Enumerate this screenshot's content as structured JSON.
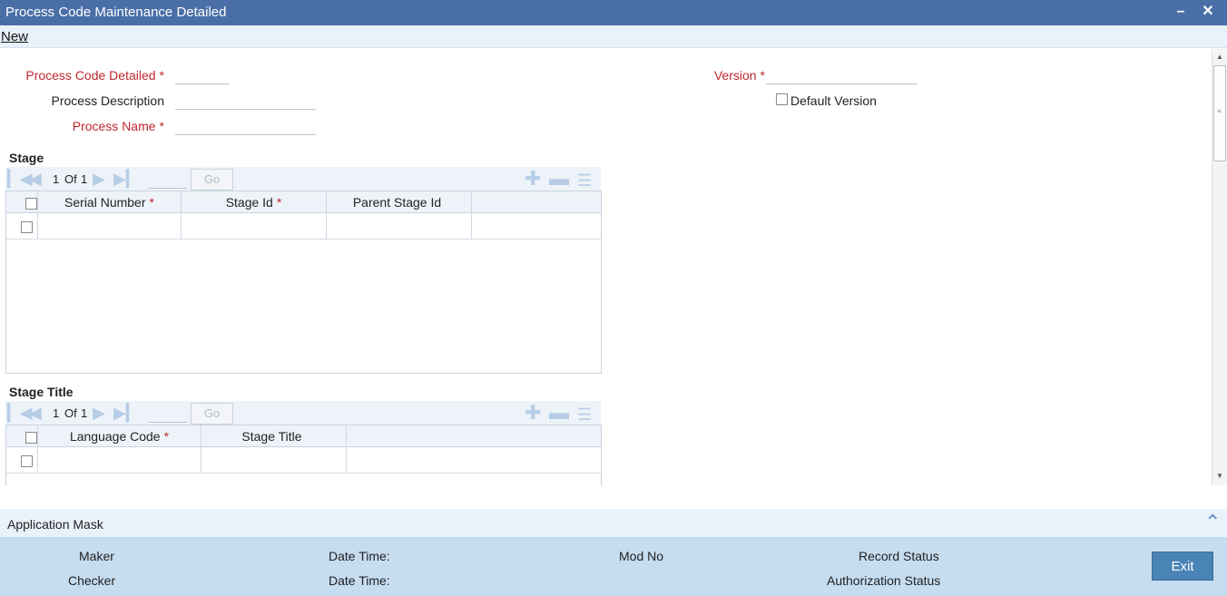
{
  "window": {
    "title": "Process Code Maintenance Detailed"
  },
  "menu": {
    "new_label": "New"
  },
  "form": {
    "process_code_label": "Process Code Detailed",
    "process_description_label": "Process Description",
    "process_name_label": "Process Name",
    "version_label": "Version",
    "default_version_label": "Default Version",
    "required_marker": "*"
  },
  "stage": {
    "title": "Stage",
    "pager": {
      "current": "1",
      "of_label": "Of",
      "total": "1",
      "go_label": "Go"
    },
    "columns": [
      {
        "label": "Serial Number",
        "required": "*"
      },
      {
        "label": "Stage Id",
        "required": "*"
      },
      {
        "label": "Parent Stage Id",
        "required": ""
      }
    ]
  },
  "stage_title": {
    "title": "Stage Title",
    "pager": {
      "current": "1",
      "of_label": "Of",
      "total": "1",
      "go_label": "Go"
    },
    "columns": [
      {
        "label": "Language Code",
        "required": "*"
      },
      {
        "label": "Stage Title",
        "required": ""
      }
    ]
  },
  "application_mask": {
    "label": "Application Mask"
  },
  "footer": {
    "maker_label": "Maker",
    "checker_label": "Checker",
    "date_time_label": "Date Time:",
    "mod_no_label": "Mod No",
    "record_status_label": "Record Status",
    "authorization_status_label": "Authorization Status",
    "exit_label": "Exit"
  },
  "icons": {
    "minimize": "minimize-icon",
    "close": "close-icon",
    "first": "first-page-icon",
    "prev": "previous-page-icon",
    "next": "next-page-icon",
    "last": "last-page-icon",
    "add_row": "add-row-icon",
    "delete_row": "delete-row-icon",
    "view_details": "list-detail-icon",
    "collapse": "chevron-up-icon"
  },
  "colors": {
    "titlebar": "#4a6fa7",
    "required": "#c0272d",
    "footer": "#c6ddf0",
    "exit_button": "#4a83b5"
  }
}
